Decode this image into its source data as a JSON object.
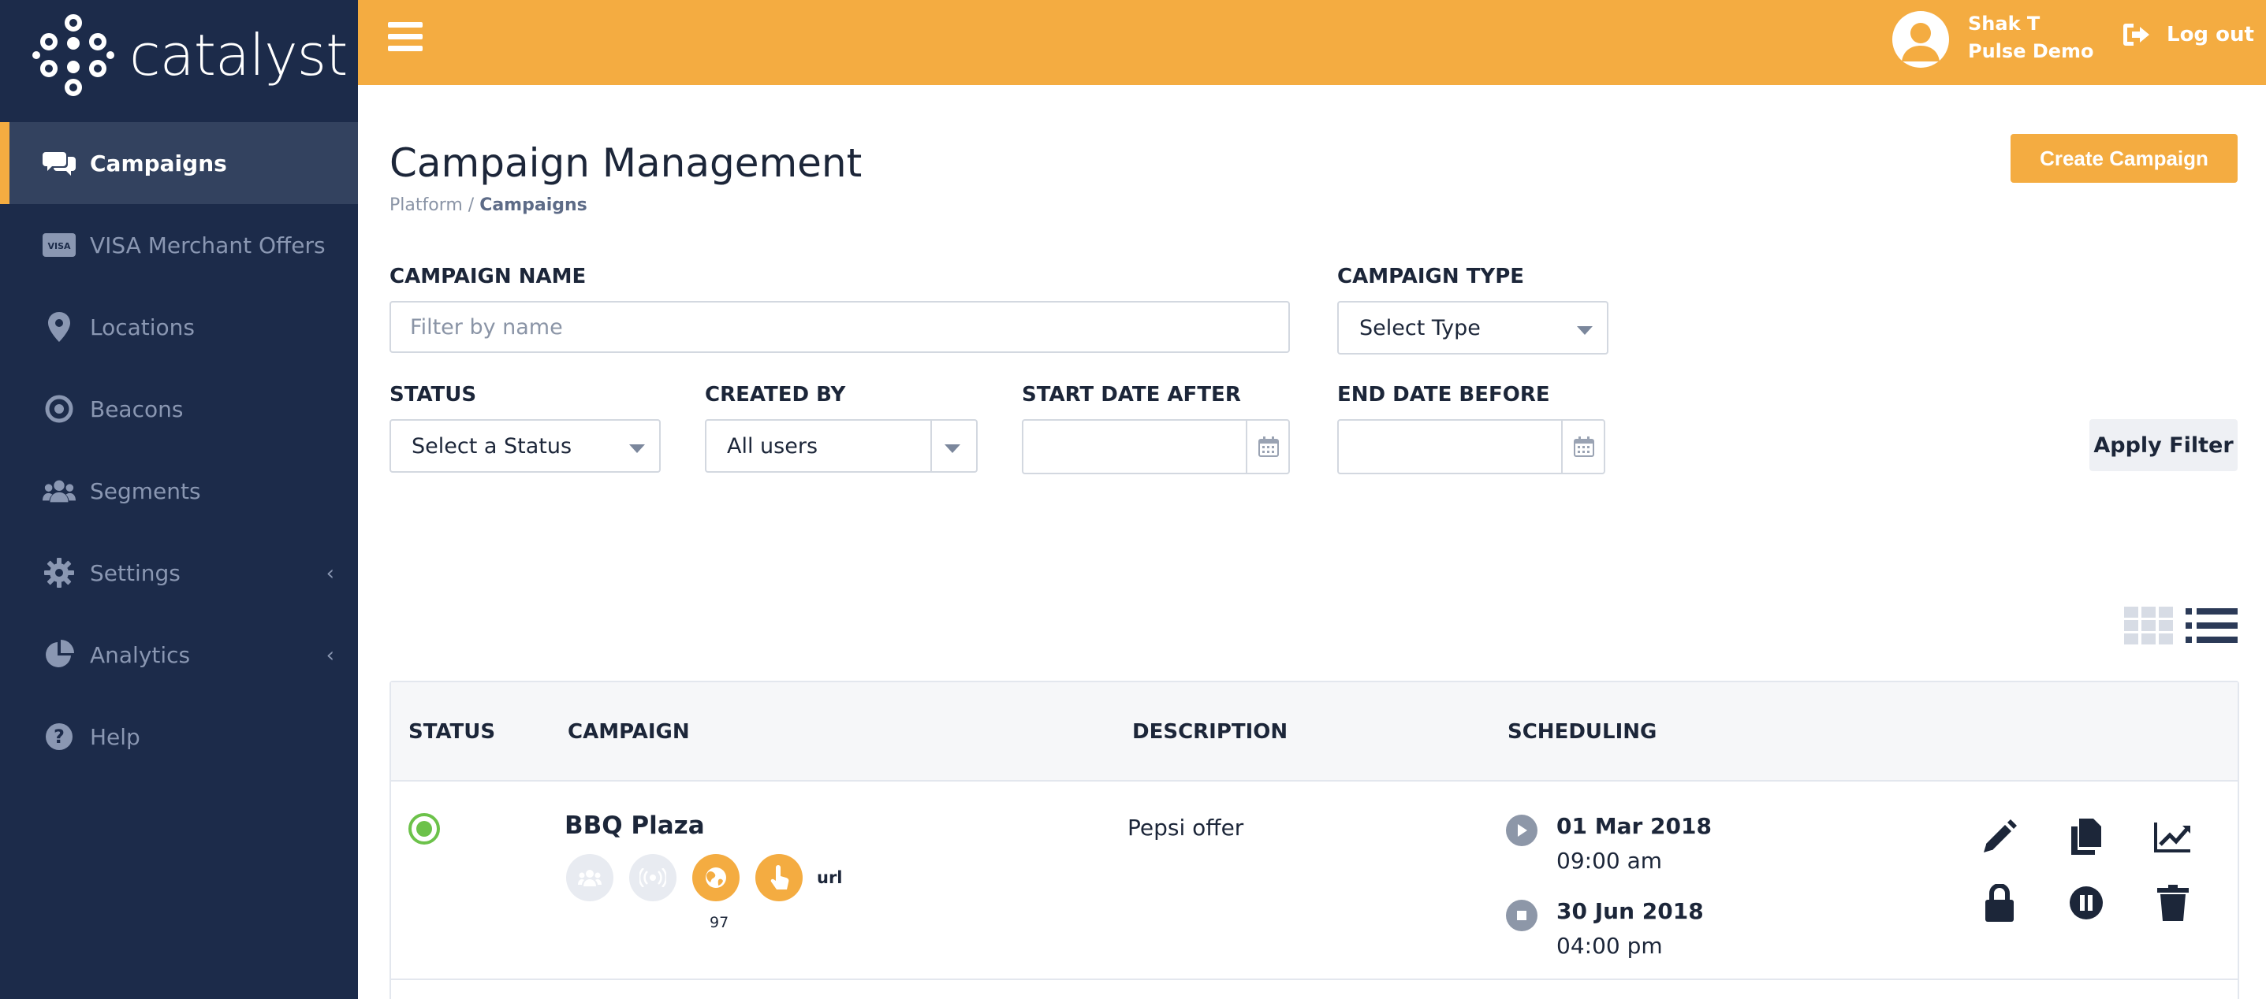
{
  "brand": {
    "name": "catalyst"
  },
  "sidebar": {
    "items": [
      {
        "label": "Campaigns",
        "icon": "comments-icon"
      },
      {
        "label": "VISA Merchant Offers",
        "icon": "visa-card-icon"
      },
      {
        "label": "Locations",
        "icon": "map-pin-icon"
      },
      {
        "label": "Beacons",
        "icon": "beacon-icon"
      },
      {
        "label": "Segments",
        "icon": "users-icon"
      },
      {
        "label": "Settings",
        "icon": "gear-icon"
      },
      {
        "label": "Analytics",
        "icon": "pie-chart-icon"
      },
      {
        "label": "Help",
        "icon": "help-icon"
      }
    ]
  },
  "topbar": {
    "user_name": "Shak T",
    "user_org": "Pulse Demo",
    "logout_label": "Log out"
  },
  "page": {
    "title": "Campaign Management",
    "breadcrumb_root": "Platform",
    "breadcrumb_sep": " / ",
    "breadcrumb_current": "Campaigns",
    "create_label": "Create Campaign"
  },
  "filters": {
    "campaign_name_label": "CAMPAIGN NAME",
    "campaign_name_placeholder": "Filter by name",
    "campaign_name_value": "",
    "campaign_type_label": "CAMPAIGN TYPE",
    "campaign_type_value": "Select Type",
    "status_label": "STATUS",
    "status_value": "Select a Status",
    "created_by_label": "CREATED BY",
    "created_by_value": "All users",
    "start_date_label": "START DATE AFTER",
    "start_date_value": "",
    "end_date_label": "END DATE BEFORE",
    "end_date_value": "",
    "apply_label": "Apply Filter"
  },
  "table": {
    "headers": [
      "STATUS",
      "CAMPAIGN",
      "DESCRIPTION",
      "SCHEDULING"
    ],
    "rows": [
      {
        "status": "active",
        "campaign": "BBQ Plaza",
        "trigger_count": "97",
        "trigger_url": "url",
        "description": "Pepsi offer",
        "start_date": "01 Mar 2018",
        "start_time": "09:00 am",
        "end_date": "30 Jun 2018",
        "end_time": "04:00 pm"
      }
    ]
  },
  "colors": {
    "accent": "#f4ac41",
    "sidebar": "#1c2b4a",
    "active_status": "#6cc24a"
  }
}
